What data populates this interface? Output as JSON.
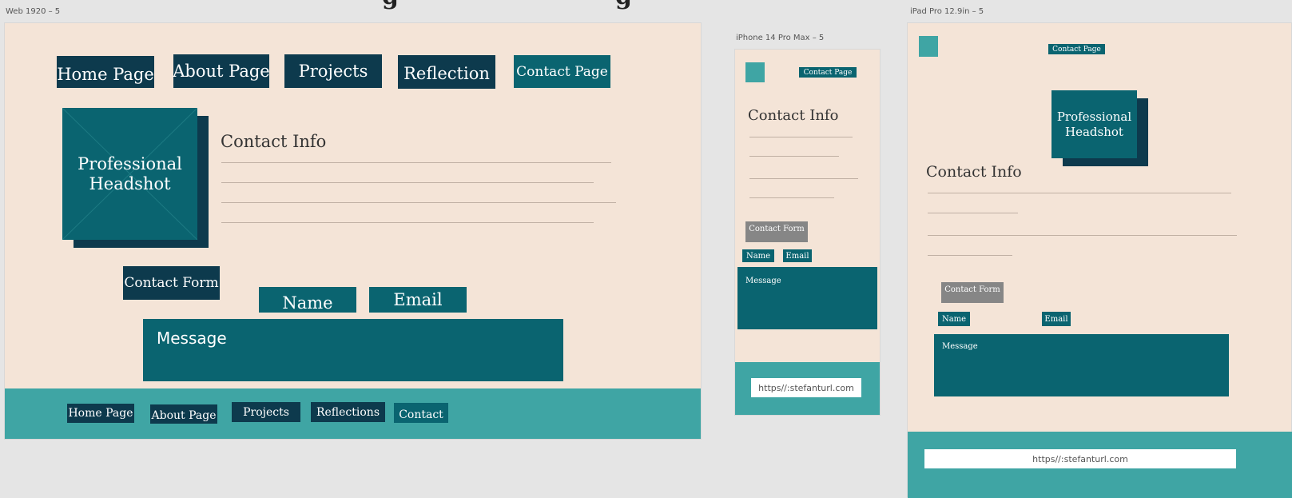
{
  "header_text": "...g... ...g...",
  "web": {
    "label": "Web 1920 – 5",
    "nav": [
      "Home Page",
      "About Page",
      "Projects",
      "Reflection",
      "Contact Page"
    ],
    "headshot": "Professional Headshot",
    "contact_info": "Contact Info",
    "contact_form": "Contact Form",
    "name": "Name",
    "email": "Email",
    "message": "Message",
    "footer_nav": [
      "Home Page",
      "About Page",
      "Projects",
      "Reflections",
      "Contact"
    ]
  },
  "iphone": {
    "label": "iPhone 14 Pro Max – 5",
    "contact_page": "Contact Page",
    "contact_info": "Contact Info",
    "contact_form": "Contact Form",
    "name": "Name",
    "email": "Email",
    "message": "Message",
    "url": "https//:stefanturl.com"
  },
  "ipad": {
    "label": "iPad Pro 12.9in – 5",
    "contact_page": "Contact Page",
    "headshot": "Professional Headshot",
    "contact_info": "Contact Info",
    "contact_form": "Contact Form",
    "name": "Name",
    "email": "Email",
    "message": "Message",
    "url": "https//:stefanturl.com"
  },
  "colors": {
    "canvas": "#e5e5e5",
    "board": "#f4e4d7",
    "dark_navy": "#0d3a4d",
    "teal": "#0a6470",
    "footer_teal": "#3fa5a4",
    "grey": "#868686"
  }
}
